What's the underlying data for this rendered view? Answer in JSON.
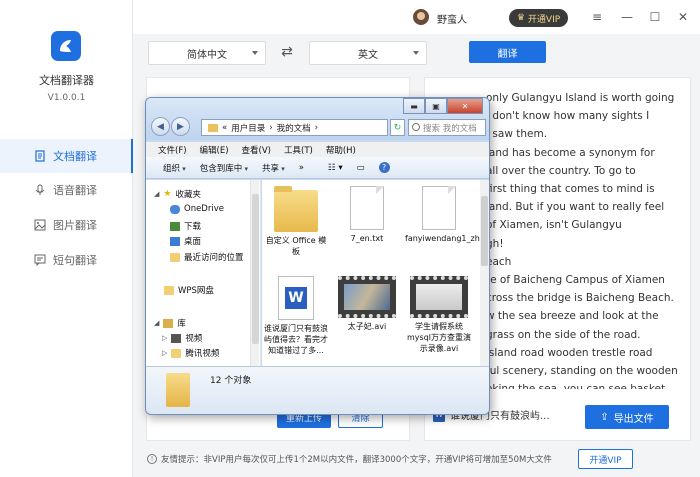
{
  "app": {
    "name": "文档翻译器",
    "version": "V1.0.0.1"
  },
  "sidebar": {
    "items": [
      {
        "label": "文档翻译",
        "icon": "document-icon",
        "active": true
      },
      {
        "label": "语音翻译",
        "icon": "microphone-icon",
        "active": false
      },
      {
        "label": "图片翻译",
        "icon": "image-icon",
        "active": false
      },
      {
        "label": "短句翻译",
        "icon": "chat-icon",
        "active": false
      }
    ]
  },
  "topbar": {
    "username": "野蛮人",
    "vip_label": "开通VIP"
  },
  "languages": {
    "source": "简体中文",
    "target": "英文",
    "translate_label": "翻译"
  },
  "right_panel": {
    "lines": [
      "only Gulangyu Island is worth going",
      "I don't know how many sights I",
      "I saw them.",
      "land has become a synonym for",
      "all over the country. To go to",
      "first thing that comes to mind is",
      "land. But if you want to really feel",
      "of Xiamen, isn't Gulangyu",
      "gh!",
      "each",
      "te of Baicheng Campus of Xiamen",
      "cross the bridge is Baicheng Beach.",
      "w the sea breeze and look at the",
      "grass on the side of the road.",
      "island road wooden trestle road",
      "ful scenery, standing on the wooden",
      "oking the sea, you can see basket"
    ],
    "file_name": "谁说厦门只有鼓浪屿...",
    "export_label": "导出文件"
  },
  "left_panel": {
    "upload_label": "重新上传",
    "clear_label": "清除"
  },
  "footer": {
    "tip": "友情提示：非VIP用户每次仅可上传1个2M以内文件，翻译3000个文字，开通VIP将可增加至50M大文件",
    "open_vip": "开通VIP"
  },
  "explorer": {
    "address": [
      "«",
      "用户目录",
      "›",
      "我的文档",
      "›"
    ],
    "search_placeholder": "搜索 我的文档",
    "menu": [
      "文件(F)",
      "编辑(E)",
      "查看(V)",
      "工具(T)",
      "帮助(H)"
    ],
    "commands": [
      "组织",
      "包含到库中",
      "共享",
      "»"
    ],
    "nav": [
      {
        "label": "收藏夹",
        "icon": "star-icon"
      },
      {
        "label": "OneDrive",
        "icon": "onedrive-icon"
      },
      {
        "label": "下载",
        "icon": "download-folder-icon"
      },
      {
        "label": "桌面",
        "icon": "desktop-icon"
      },
      {
        "label": "最近访问的位置",
        "icon": "recent-places-icon"
      },
      {
        "label": "WPS网盘",
        "icon": "wps-drive-icon"
      },
      {
        "label": "库",
        "icon": "library-icon"
      },
      {
        "label": "视频",
        "icon": "videos-icon"
      },
      {
        "label": "腾讯视频",
        "icon": "tencent-video-icon"
      }
    ],
    "files": [
      {
        "name": "自定义 Office 模板",
        "kind": "folder"
      },
      {
        "name": "7_en.txt",
        "kind": "txt"
      },
      {
        "name": "fanyiwendang1_zh.txt",
        "kind": "txt"
      },
      {
        "name": "谁说厦门只有鼓浪屿值得去？看完才知道错过了多...",
        "kind": "word"
      },
      {
        "name": "太子妃.avi",
        "kind": "video"
      },
      {
        "name": "学生请假系统mysql万方查重演示录像.avi",
        "kind": "video"
      }
    ],
    "item_count": "12 个对象"
  },
  "colors": {
    "accent": "#1e6fe0",
    "vip_gold": "#f3d48a"
  }
}
